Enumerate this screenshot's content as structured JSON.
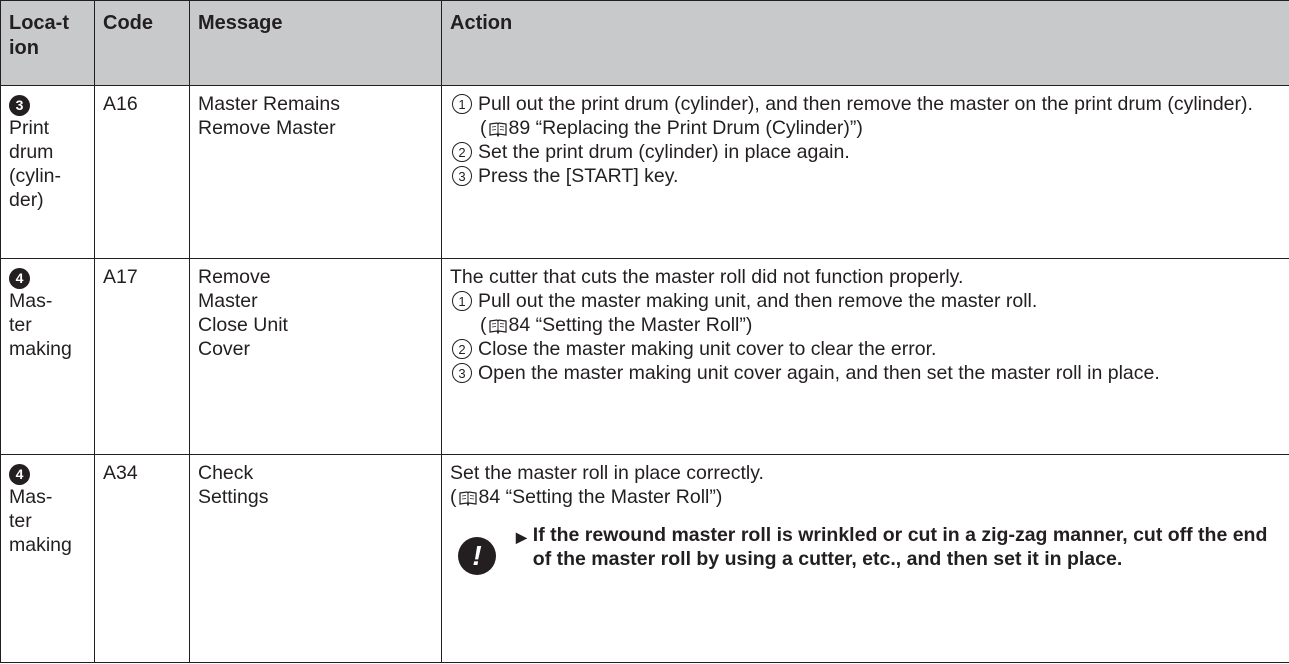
{
  "headers": {
    "location": "Loca-tion",
    "code": "Code",
    "message": "Message",
    "action": "Action"
  },
  "rows": [
    {
      "loc_num": "3",
      "location": "Print drum (cylin-der)",
      "code": "A16",
      "message": "Master Remains Remove Master",
      "intro": "",
      "steps": [
        {
          "num": "1",
          "text": "Pull out the print drum (cylinder), and then remove the master on the print drum (cylinder).",
          "ref": "89 “Replacing the Print Drum (Cylinder)”)"
        },
        {
          "num": "2",
          "text": "Set the print drum (cylinder) in place again.",
          "ref": ""
        },
        {
          "num": "3",
          "text": "Press the [START] key.",
          "ref": ""
        }
      ]
    },
    {
      "loc_num": "4",
      "location": "Mas-ter making",
      "code": "A17",
      "message": "Remove Master Close Unit Cover",
      "intro": "The cutter that cuts the master roll did not function properly.",
      "steps": [
        {
          "num": "1",
          "text": "Pull out the master making unit, and then remove the master roll.",
          "ref": "84 “Setting the Master Roll”)"
        },
        {
          "num": "2",
          "text": "Close the master making unit cover to clear the error.",
          "ref": ""
        },
        {
          "num": "3",
          "text": "Open the master making unit cover again, and then set the master roll in place.",
          "ref": ""
        }
      ]
    },
    {
      "loc_num": "4",
      "location": "Mas-ter making",
      "code": "A34",
      "message": "Check Settings",
      "intro": "Set the master roll in place correctly.",
      "ref": "84 “Setting the Master Roll”)",
      "note": "If the rewound master roll is wrinkled or cut in a zig-zag manner, cut off the end of the master roll by using a cutter, etc., and then set it in place."
    }
  ]
}
